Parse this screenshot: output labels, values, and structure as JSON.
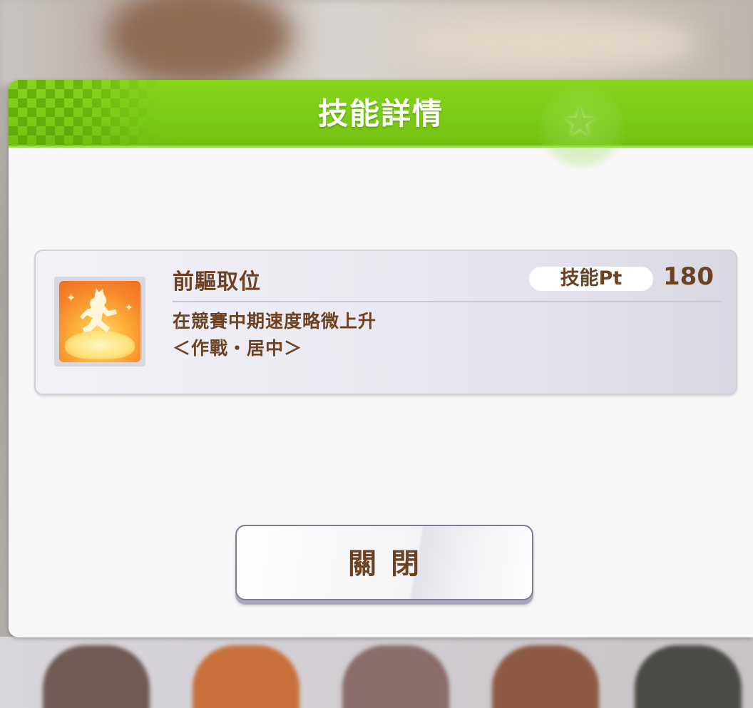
{
  "dialog": {
    "title": "技能詳情"
  },
  "skill": {
    "name": "前驅取位",
    "pt_label": "技能Pt",
    "pt_value": "180",
    "description_line1": "在競賽中期速度略微上升",
    "description_line2": "＜作戰・居中＞",
    "icon": "running-horse-girl-icon"
  },
  "buttons": {
    "close_label": "關閉"
  },
  "colors": {
    "header_green": "#7ccb16",
    "text_brown": "#6b4224",
    "icon_orange": "#f7862a"
  }
}
